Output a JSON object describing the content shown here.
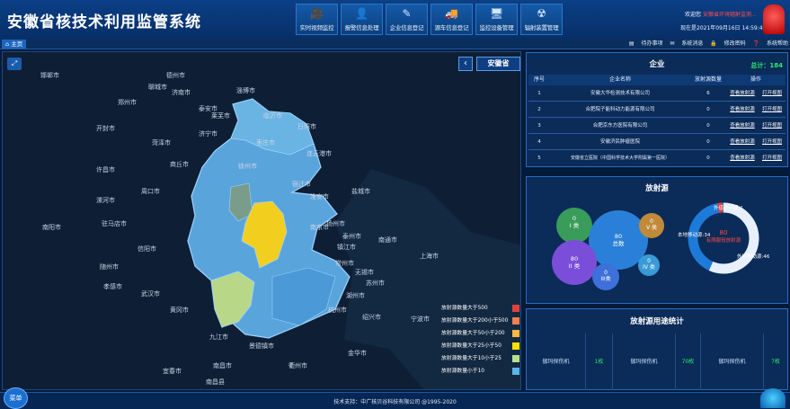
{
  "header": {
    "title": "安徽省核技术利用监管系统",
    "nav": [
      {
        "label": "实时视频监控",
        "icon": "camera-icon"
      },
      {
        "label": "报警信息处理",
        "icon": "alarm-user-icon"
      },
      {
        "label": "企业信息登记",
        "icon": "edit-icon"
      },
      {
        "label": "源车信息登记",
        "icon": "truck-icon"
      },
      {
        "label": "监控设备管理",
        "icon": "monitor-icon"
      },
      {
        "label": "辐射装置管理",
        "icon": "radiation-device-icon"
      }
    ],
    "welcome_label": "欢迎您",
    "user": "安徽省环境辐射监测...",
    "datetime": "现在是2021年09月16日 14:59:49"
  },
  "tabs": {
    "home": "主页"
  },
  "toolbar": {
    "todo": "待办事项",
    "messages": "系统消息",
    "password": "修改密码",
    "help": "系统帮助"
  },
  "map": {
    "province_button": "安徽省",
    "cities": [
      {
        "name": "邯郸市"
      },
      {
        "name": "德州市"
      },
      {
        "name": "聊城市"
      },
      {
        "name": "济南市"
      },
      {
        "name": "泰安市"
      },
      {
        "name": "淄博市"
      },
      {
        "name": "莱芜市"
      },
      {
        "name": "临沂市"
      },
      {
        "name": "济宁市"
      },
      {
        "name": "日照市"
      },
      {
        "name": "菏泽市"
      },
      {
        "name": "枣庄市"
      },
      {
        "name": "连云港市"
      },
      {
        "name": "开封市"
      },
      {
        "name": "郑州市"
      },
      {
        "name": "商丘市"
      },
      {
        "name": "徐州市"
      },
      {
        "name": "宿迁市"
      },
      {
        "name": "淮安市"
      },
      {
        "name": "许昌市"
      },
      {
        "name": "周口市"
      },
      {
        "name": "盐城市"
      },
      {
        "name": "漯河市"
      },
      {
        "name": "驻马店市"
      },
      {
        "name": "扬州市"
      },
      {
        "name": "泰州市"
      },
      {
        "name": "南通市"
      },
      {
        "name": "南阳市"
      },
      {
        "name": "信阳市"
      },
      {
        "name": "南京市"
      },
      {
        "name": "镇江市"
      },
      {
        "name": "常州市"
      },
      {
        "name": "无锡市"
      },
      {
        "name": "苏州市"
      },
      {
        "name": "上海市"
      },
      {
        "name": "随州市"
      },
      {
        "name": "孝感市"
      },
      {
        "name": "武汉市"
      },
      {
        "name": "黄冈市"
      },
      {
        "name": "湖州市"
      },
      {
        "name": "杭州市"
      },
      {
        "name": "绍兴市"
      },
      {
        "name": "宁波市"
      },
      {
        "name": "九江市"
      },
      {
        "name": "景德镇市"
      },
      {
        "name": "南昌市"
      },
      {
        "name": "衢州市"
      },
      {
        "name": "金华市"
      },
      {
        "name": "宜春市"
      },
      {
        "name": "南昌县"
      }
    ],
    "legend": [
      {
        "label": "放射源数量大于500",
        "color": "#e0413c"
      },
      {
        "label": "放射源数量大于200小于500",
        "color": "#f08050"
      },
      {
        "label": "放射源数量大于50小于200",
        "color": "#f5b840"
      },
      {
        "label": "放射源数量大于25小于50",
        "color": "#ffe000"
      },
      {
        "label": "放射源数量大于10小于25",
        "color": "#b8e08a"
      },
      {
        "label": "放射源数量小于10",
        "color": "#5ab4e6"
      }
    ]
  },
  "enterprise": {
    "title": "企业",
    "total": "总计：184",
    "columns": [
      "序号",
      "企业名称",
      "放射源数量",
      "操作"
    ],
    "rows": [
      {
        "no": "1",
        "name": "安徽大华检测技术有限公司",
        "count": "6",
        "op1": "查看放射源",
        "op2": "打开视图"
      },
      {
        "no": "2",
        "name": "合肥院子能科动力能源有限公司",
        "count": "0",
        "op1": "查看放射源",
        "op2": "打开视图"
      },
      {
        "no": "3",
        "name": "合肥京东方医院有限公司",
        "count": "0",
        "op1": "查看放射源",
        "op2": "打开视图"
      },
      {
        "no": "4",
        "name": "安徽济民肿瘤医院",
        "count": "0",
        "op1": "查看放射源",
        "op2": "打开视图"
      },
      {
        "no": "5",
        "name": "安徽省立医院（中国科学技术大学附属第一医院）",
        "count": "0",
        "op1": "查看放射源",
        "op2": "打开视图"
      }
    ]
  },
  "radiation": {
    "title": "放射源",
    "bubbles": [
      {
        "value": "0",
        "label": "I 类",
        "color": "#3a9c5a"
      },
      {
        "value": "80",
        "label": "总数",
        "color": "#2a80d8"
      },
      {
        "value": "0",
        "label": "V 类",
        "color": "#c08a3a"
      },
      {
        "value": "80",
        "label": "II 类",
        "color": "#7a4ed8"
      },
      {
        "value": "0",
        "label": "III类",
        "color": "#3d70d8"
      },
      {
        "value": "0",
        "label": "IV 类",
        "color": "#3a9ad8"
      }
    ],
    "donut": {
      "center_value": "80",
      "center_label": "有限服役放射源",
      "outer_label": "外借移动源:1",
      "local_label": "本地移动源:34",
      "external_label": "外地移动源:46",
      "segments": [
        {
          "name": "本地移动源",
          "value": 34,
          "color": "#1d7ad8"
        },
        {
          "name": "外地移动源",
          "value": 46,
          "color": "#e8f0ff"
        },
        {
          "name": "外借移动源",
          "value": 1,
          "color": "#e83a3a"
        }
      ]
    }
  },
  "usage_stats": {
    "title": "放射源用途统计",
    "items": [
      {
        "label": "伽玛探伤机",
        "count": "1枚"
      },
      {
        "label": "伽玛探伤机",
        "count": "70枚"
      },
      {
        "label": "伽玛探伤机",
        "count": "7枚"
      }
    ]
  },
  "footer": {
    "text": "技术支持：中广核贝谷科技有限公司 @1995-2020",
    "menu": "菜单"
  }
}
